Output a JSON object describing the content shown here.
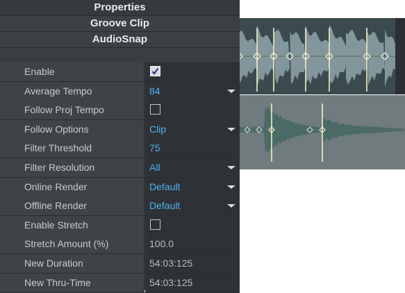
{
  "panel": {
    "title": "Properties",
    "section": "Groove Clip",
    "subsection": "AudioSnap",
    "rows": [
      {
        "name": "Enable",
        "type": "checkbox",
        "checked": true
      },
      {
        "name": "Average Tempo",
        "type": "dropdown",
        "value": "84"
      },
      {
        "name": "Follow Proj Tempo",
        "type": "checkbox",
        "checked": false
      },
      {
        "name": "Follow Options",
        "type": "dropdown",
        "value": "Clip"
      },
      {
        "name": "Filter Threshold",
        "type": "number",
        "value": "75"
      },
      {
        "name": "Filter Resolution",
        "type": "dropdown",
        "value": "All"
      },
      {
        "name": "Online Render",
        "type": "dropdown",
        "value": "Default"
      },
      {
        "name": "Offline Render",
        "type": "dropdown",
        "value": "Default"
      },
      {
        "name": "Enable Stretch",
        "type": "checkbox",
        "checked": false
      },
      {
        "name": "Stretch Amount (%)",
        "type": "readonly",
        "value": "100.0"
      },
      {
        "name": "New Duration",
        "type": "readonly",
        "value": "54:03:125"
      },
      {
        "name": "New Thru-Time",
        "type": "readonly",
        "value": "54:03:125"
      }
    ]
  },
  "colors": {
    "value_text": "#4fb3ee",
    "label_text": "#c9cbce",
    "panel_bg": "#3a3d42",
    "waveform_top": "#8fa3a8",
    "waveform_bottom": "#4a6a66",
    "marker": "#f3f0c8"
  },
  "clips": [
    {
      "name": "audio-clip-top",
      "transient_markers": 8
    },
    {
      "name": "audio-clip-bottom",
      "transient_markers": 5
    }
  ]
}
